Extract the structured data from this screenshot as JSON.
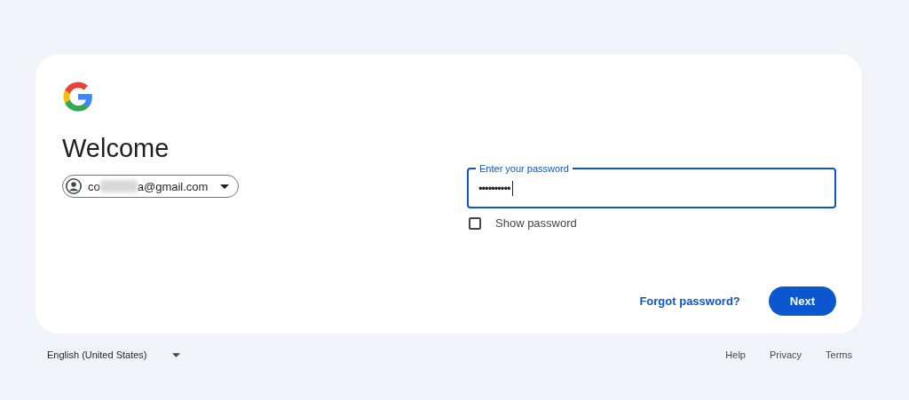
{
  "card": {
    "heading": "Welcome",
    "account": {
      "email_start": "co",
      "email_end": "a@gmail.com"
    },
    "password_field": {
      "label": "Enter your password",
      "value": "••••••••••",
      "focused": true
    },
    "show_password": {
      "label": "Show password",
      "checked": false
    },
    "forgot_link": "Forgot password?",
    "next_button": "Next"
  },
  "footer": {
    "language": "English (United States)",
    "links": [
      "Help",
      "Privacy",
      "Terms"
    ]
  }
}
